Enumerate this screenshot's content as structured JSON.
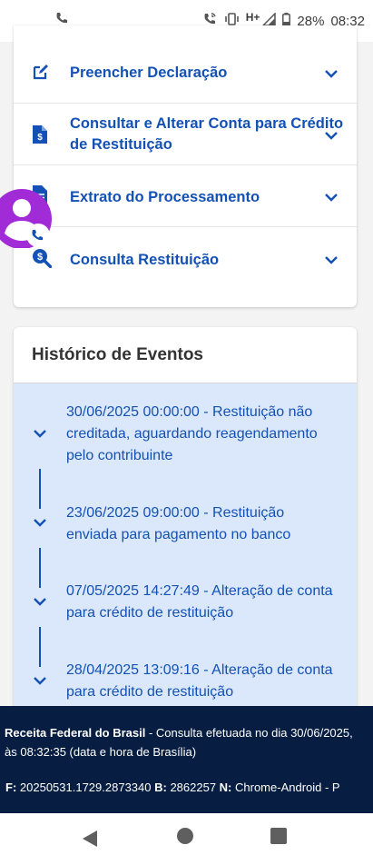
{
  "status_bar": {
    "battery": "28%",
    "time": "08:32",
    "network": "H+"
  },
  "menu": {
    "items": [
      {
        "label": "Preencher Declaração",
        "icon": "edit-icon"
      },
      {
        "label": "Consultar e Alterar Conta para Crédito de Restituição",
        "icon": "document-money-icon"
      },
      {
        "label": "Extrato do Processamento",
        "icon": "document-list-icon"
      },
      {
        "label": "Consulta Restituição",
        "icon": "search-money-icon"
      }
    ]
  },
  "history": {
    "title": "Histórico de Eventos",
    "events": [
      "30/06/2025 00:00:00 - Restituição não creditada, aguardando reagendamento pelo contribuinte",
      "23/06/2025 09:00:00 - Restituição enviada para pagamento no banco",
      "07/05/2025 14:27:49 - Alteração de conta para crédito de restituição",
      "28/04/2025 13:09:16 - Alteração de conta para crédito de restituição"
    ]
  },
  "footer": {
    "org": "Receita Federal do Brasil",
    "consult_text": " - Consulta efetuada no dia 30/06/2025, às 08:32:35 (data e hora de Brasília)",
    "f_label": "F:",
    "f_value": " 20250531.1729.2873340 ",
    "b_label": "B:",
    "b_value": " 2862257 ",
    "n_label": "N:",
    "n_value": " Chrome-Android - P"
  },
  "colors": {
    "primary": "#1351b4",
    "timeline_bg": "#dbe8fb",
    "footer_bg": "#071d41",
    "avatar": "#a12bd6"
  }
}
